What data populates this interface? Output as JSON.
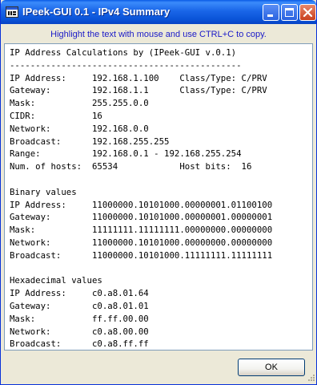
{
  "window": {
    "title": "IPeek-GUI 0.1 - IPv4 Summary",
    "hint": "Highlight the text with mouse and use CTRL+C to copy."
  },
  "content": {
    "lines": [
      "IP Address Calculations by (IPeek-GUI v.0.1)",
      "---------------------------------------------",
      "IP Address:     192.168.1.100    Class/Type: C/PRV",
      "Gateway:        192.168.1.1      Class/Type: C/PRV",
      "Mask:           255.255.0.0",
      "CIDR:           16",
      "Network:        192.168.0.0",
      "Broadcast:      192.168.255.255",
      "Range:          192.168.0.1 - 192.168.255.254",
      "Num. of hosts:  65534            Host bits:  16",
      "",
      "Binary values",
      "IP Address:     11000000.10101000.00000001.01100100",
      "Gateway:        11000000.10101000.00000001.00000001",
      "Mask:           11111111.11111111.00000000.00000000",
      "Network:        11000000.10101000.00000000.00000000",
      "Broadcast:      11000000.10101000.11111111.11111111",
      "",
      "Hexadecimal values",
      "IP Address:     c0.a8.01.64",
      "Gateway:        c0.a8.01.01",
      "Mask:           ff.ff.00.00",
      "Network:        c0.a8.00.00",
      "Broadcast:      c0.a8.ff.ff"
    ]
  },
  "buttons": {
    "ok_label": "OK"
  },
  "icons": {
    "app": "app-window-icon",
    "minimize": "minimize-icon",
    "maximize": "maximize-icon",
    "close": "close-icon",
    "grip": "resize-grip-icon"
  },
  "colors": {
    "titlebar": "#0a54d8",
    "hint_text": "#1a1ac8",
    "close_button": "#c8401f",
    "window_bg": "#ece9d8"
  }
}
